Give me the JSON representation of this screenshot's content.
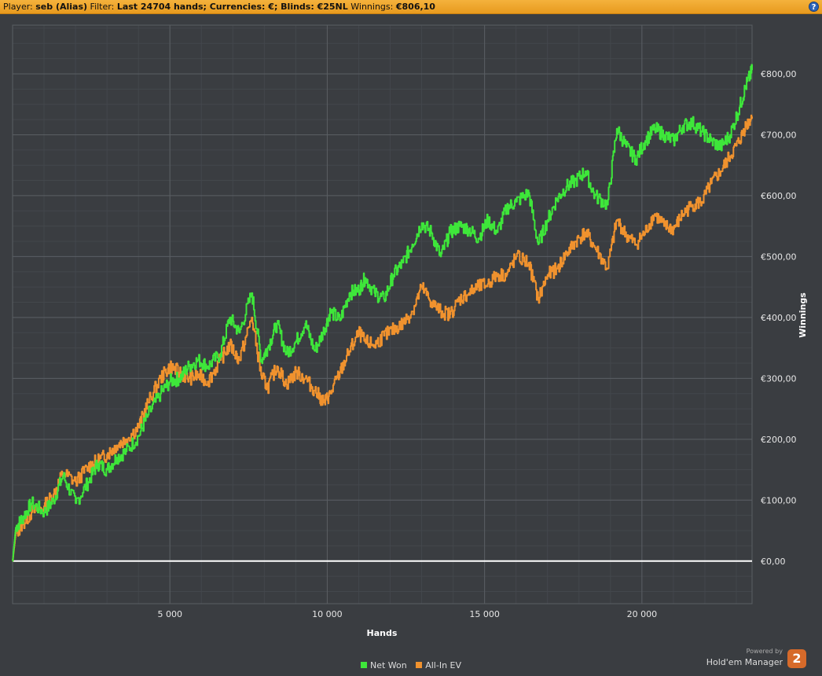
{
  "header": {
    "player_label": "Player:",
    "player_value": "seb (Alias)",
    "filter_label": "Filter:",
    "filter_value": "Last 24704 hands; Currencies: €; Blinds: €25NL",
    "winnings_label": "Winnings:",
    "winnings_value": "€806,10",
    "help_icon": "?"
  },
  "branding": {
    "powered_by": "Powered by",
    "product": "Hold'em Manager",
    "logo_text": "2"
  },
  "colors": {
    "background": "#3a3d41",
    "net_won": "#3ee63a",
    "allin_ev": "#f0922e",
    "zero_line": "#ffffff",
    "grid": "#4e5257"
  },
  "chart_data": {
    "type": "line",
    "title": "",
    "xlabel": "Hands",
    "ylabel": "Winnings",
    "xlim": [
      0,
      23500
    ],
    "ylim": [
      -70,
      880
    ],
    "x_ticks": [
      5000,
      10000,
      15000,
      20000
    ],
    "x_tick_labels": [
      "5 000",
      "10 000",
      "15 000",
      "20 000"
    ],
    "y_ticks": [
      0,
      100,
      200,
      300,
      400,
      500,
      600,
      700,
      800
    ],
    "y_tick_labels": [
      "€0,00",
      "€100,00",
      "€200,00",
      "€300,00",
      "€400,00",
      "€500,00",
      "€600,00",
      "€700,00",
      "€800,00"
    ],
    "grid": true,
    "legend_position": "bottom-center",
    "series": [
      {
        "name": "Net Won",
        "color": "#3ee63a",
        "points": [
          [
            0,
            0
          ],
          [
            100,
            55
          ],
          [
            300,
            70
          ],
          [
            600,
            95
          ],
          [
            1000,
            80
          ],
          [
            1300,
            100
          ],
          [
            1600,
            140
          ],
          [
            2000,
            95
          ],
          [
            2400,
            130
          ],
          [
            2700,
            160
          ],
          [
            3000,
            150
          ],
          [
            3300,
            170
          ],
          [
            3600,
            180
          ],
          [
            4000,
            205
          ],
          [
            4300,
            240
          ],
          [
            4700,
            275
          ],
          [
            5000,
            295
          ],
          [
            5300,
            300
          ],
          [
            5600,
            320
          ],
          [
            5900,
            330
          ],
          [
            6200,
            320
          ],
          [
            6600,
            340
          ],
          [
            6900,
            400
          ],
          [
            7200,
            375
          ],
          [
            7600,
            440
          ],
          [
            7900,
            330
          ],
          [
            8100,
            350
          ],
          [
            8400,
            390
          ],
          [
            8700,
            340
          ],
          [
            9000,
            360
          ],
          [
            9300,
            390
          ],
          [
            9600,
            345
          ],
          [
            9900,
            380
          ],
          [
            10100,
            410
          ],
          [
            10400,
            395
          ],
          [
            10700,
            440
          ],
          [
            11000,
            445
          ],
          [
            11200,
            465
          ],
          [
            11500,
            440
          ],
          [
            11800,
            430
          ],
          [
            12100,
            470
          ],
          [
            12400,
            490
          ],
          [
            12700,
            520
          ],
          [
            13000,
            555
          ],
          [
            13300,
            540
          ],
          [
            13600,
            500
          ],
          [
            13900,
            540
          ],
          [
            14200,
            550
          ],
          [
            14500,
            545
          ],
          [
            14800,
            530
          ],
          [
            15100,
            560
          ],
          [
            15400,
            540
          ],
          [
            15700,
            580
          ],
          [
            16000,
            590
          ],
          [
            16400,
            605
          ],
          [
            16700,
            520
          ],
          [
            17000,
            560
          ],
          [
            17300,
            595
          ],
          [
            17600,
            615
          ],
          [
            17900,
            625
          ],
          [
            18200,
            640
          ],
          [
            18500,
            600
          ],
          [
            18900,
            585
          ],
          [
            19200,
            710
          ],
          [
            19500,
            680
          ],
          [
            19800,
            660
          ],
          [
            20100,
            690
          ],
          [
            20400,
            710
          ],
          [
            20700,
            700
          ],
          [
            21000,
            690
          ],
          [
            21300,
            715
          ],
          [
            21600,
            720
          ],
          [
            21900,
            705
          ],
          [
            22200,
            690
          ],
          [
            22500,
            680
          ],
          [
            22800,
            700
          ],
          [
            23100,
            745
          ],
          [
            23300,
            780
          ],
          [
            23500,
            806
          ]
        ]
      },
      {
        "name": "All-In EV",
        "color": "#f0922e",
        "points": [
          [
            0,
            0
          ],
          [
            100,
            45
          ],
          [
            300,
            60
          ],
          [
            600,
            80
          ],
          [
            1000,
            90
          ],
          [
            1300,
            110
          ],
          [
            1600,
            145
          ],
          [
            2000,
            130
          ],
          [
            2400,
            155
          ],
          [
            2700,
            165
          ],
          [
            3000,
            175
          ],
          [
            3300,
            190
          ],
          [
            3600,
            200
          ],
          [
            4000,
            220
          ],
          [
            4300,
            260
          ],
          [
            4700,
            300
          ],
          [
            5000,
            320
          ],
          [
            5300,
            310
          ],
          [
            5600,
            300
          ],
          [
            5900,
            305
          ],
          [
            6200,
            295
          ],
          [
            6600,
            330
          ],
          [
            6900,
            355
          ],
          [
            7200,
            330
          ],
          [
            7600,
            400
          ],
          [
            7900,
            305
          ],
          [
            8100,
            285
          ],
          [
            8400,
            320
          ],
          [
            8700,
            290
          ],
          [
            9000,
            310
          ],
          [
            9300,
            300
          ],
          [
            9600,
            280
          ],
          [
            9900,
            260
          ],
          [
            10100,
            275
          ],
          [
            10400,
            310
          ],
          [
            10700,
            345
          ],
          [
            11000,
            375
          ],
          [
            11200,
            360
          ],
          [
            11500,
            355
          ],
          [
            11800,
            370
          ],
          [
            12100,
            380
          ],
          [
            12400,
            390
          ],
          [
            12700,
            410
          ],
          [
            13000,
            450
          ],
          [
            13300,
            425
          ],
          [
            13600,
            410
          ],
          [
            13900,
            405
          ],
          [
            14200,
            430
          ],
          [
            14500,
            440
          ],
          [
            14800,
            450
          ],
          [
            15100,
            455
          ],
          [
            15400,
            470
          ],
          [
            15700,
            470
          ],
          [
            16000,
            500
          ],
          [
            16400,
            490
          ],
          [
            16700,
            430
          ],
          [
            17000,
            470
          ],
          [
            17300,
            480
          ],
          [
            17600,
            505
          ],
          [
            17900,
            525
          ],
          [
            18200,
            540
          ],
          [
            18500,
            515
          ],
          [
            18900,
            480
          ],
          [
            19200,
            560
          ],
          [
            19500,
            535
          ],
          [
            19800,
            520
          ],
          [
            20100,
            540
          ],
          [
            20400,
            570
          ],
          [
            20700,
            550
          ],
          [
            21000,
            545
          ],
          [
            21300,
            570
          ],
          [
            21600,
            585
          ],
          [
            21900,
            590
          ],
          [
            22200,
            620
          ],
          [
            22500,
            640
          ],
          [
            22800,
            665
          ],
          [
            23100,
            690
          ],
          [
            23300,
            715
          ],
          [
            23500,
            730
          ]
        ]
      }
    ]
  }
}
